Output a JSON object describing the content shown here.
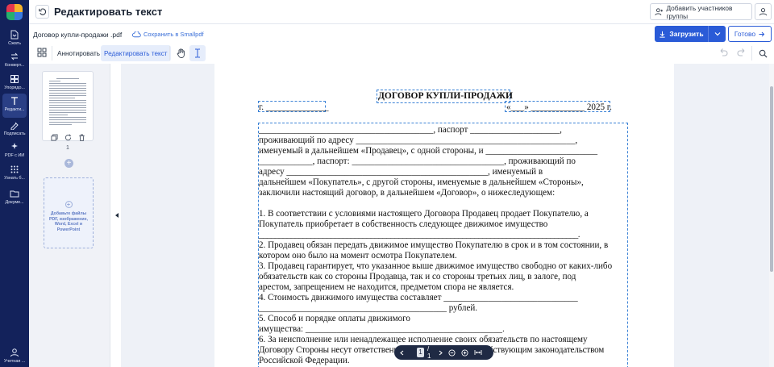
{
  "sidebar": {
    "items": [
      {
        "label": "Сжать",
        "icon": "compress-icon"
      },
      {
        "label": "Конверт...",
        "icon": "convert-icon"
      },
      {
        "label": "Упорядо...",
        "icon": "organize-icon"
      },
      {
        "label": "Редакти...",
        "icon": "edit-text-icon"
      },
      {
        "label": "Подписать",
        "icon": "sign-icon"
      },
      {
        "label": "PDF с ИИ",
        "icon": "ai-sparkle-icon"
      },
      {
        "label": "Узнать б...",
        "icon": "apps-grid-icon"
      },
      {
        "label": "Докуме...",
        "icon": "documents-folder-icon"
      },
      {
        "label": "Учетная ...",
        "icon": "account-icon"
      }
    ]
  },
  "header": {
    "title": "Редактировать текст",
    "add_participants": "Добавить участников группы"
  },
  "file": {
    "name": "Договор купли-продажи .pdf",
    "saved": "Сохранить в Smallpdf"
  },
  "actions": {
    "download": "Загрузить",
    "done": "Готово"
  },
  "toolbar": {
    "annotate": "Аннотировать",
    "edit_text": "Редактировать текст"
  },
  "thumbnails": {
    "page_number": "1",
    "dropzone_text": "Добавьте файлы PDF, изображение, Word, Excel и PowerPoint"
  },
  "document": {
    "title": "ДОГОВОР КУПЛИ-ПРОДАЖИ",
    "city_line": "г. ______________",
    "date_line": "«___» ____________ 2025 г.",
    "lines": [
      "_______________________________________, паспорт ____________________,",
      "проживающий по адресу _________________________________________________,",
      "именуемый в дальнейшем «Продавец», с одной стороны, и _________________________",
      "____________, паспорт: __________________________________, проживающий по",
      "адресу _____________________________________________, именуемый в",
      "дальнейшем «Покупатель», с другой стороны, именуемые в дальнейшем «Стороны»,",
      "заключили настоящий договор, в дальнейшем «Договор», о нижеследующем:",
      "",
      "1. В соответствии с условиями настоящего Договора Продавец продает Покупателю, а",
      "Покупатель приобретает в собственность следующее движимое имущество",
      "________________________________________________________________________________.",
      "2. Продавец обязан передать движимое имущество Покупателю в срок  и в том состоянии, в",
      "котором оно было на момент осмотра Покупателем.",
      "3. Продавец гарантирует, что указанное выше движимое имущество свободно от каких-либо",
      "обязательств как со стороны Продавца, так и со стороны третьих лиц, в залоге, под",
      "арестом, запрещением не находится, предметом спора не является.",
      "4. Стоимость движимого имущества составляет  ______________________________",
      "__________________________________________ рублей.",
      "5. Способ и порядке оплаты движимого",
      "имущества: ____________________________________________.",
      "6. За неисполнение или ненадлежащее исполнение своих обязательств по настоящему",
      "Договору Стороны несут ответственность в соответствии с действующим законодательством",
      "Российской Федерации."
    ]
  },
  "pager": {
    "current": "1",
    "total": "/ 1"
  },
  "colors": {
    "rail": "#13225b",
    "accent": "#2a5bd7",
    "selection": "#3b82d6"
  }
}
